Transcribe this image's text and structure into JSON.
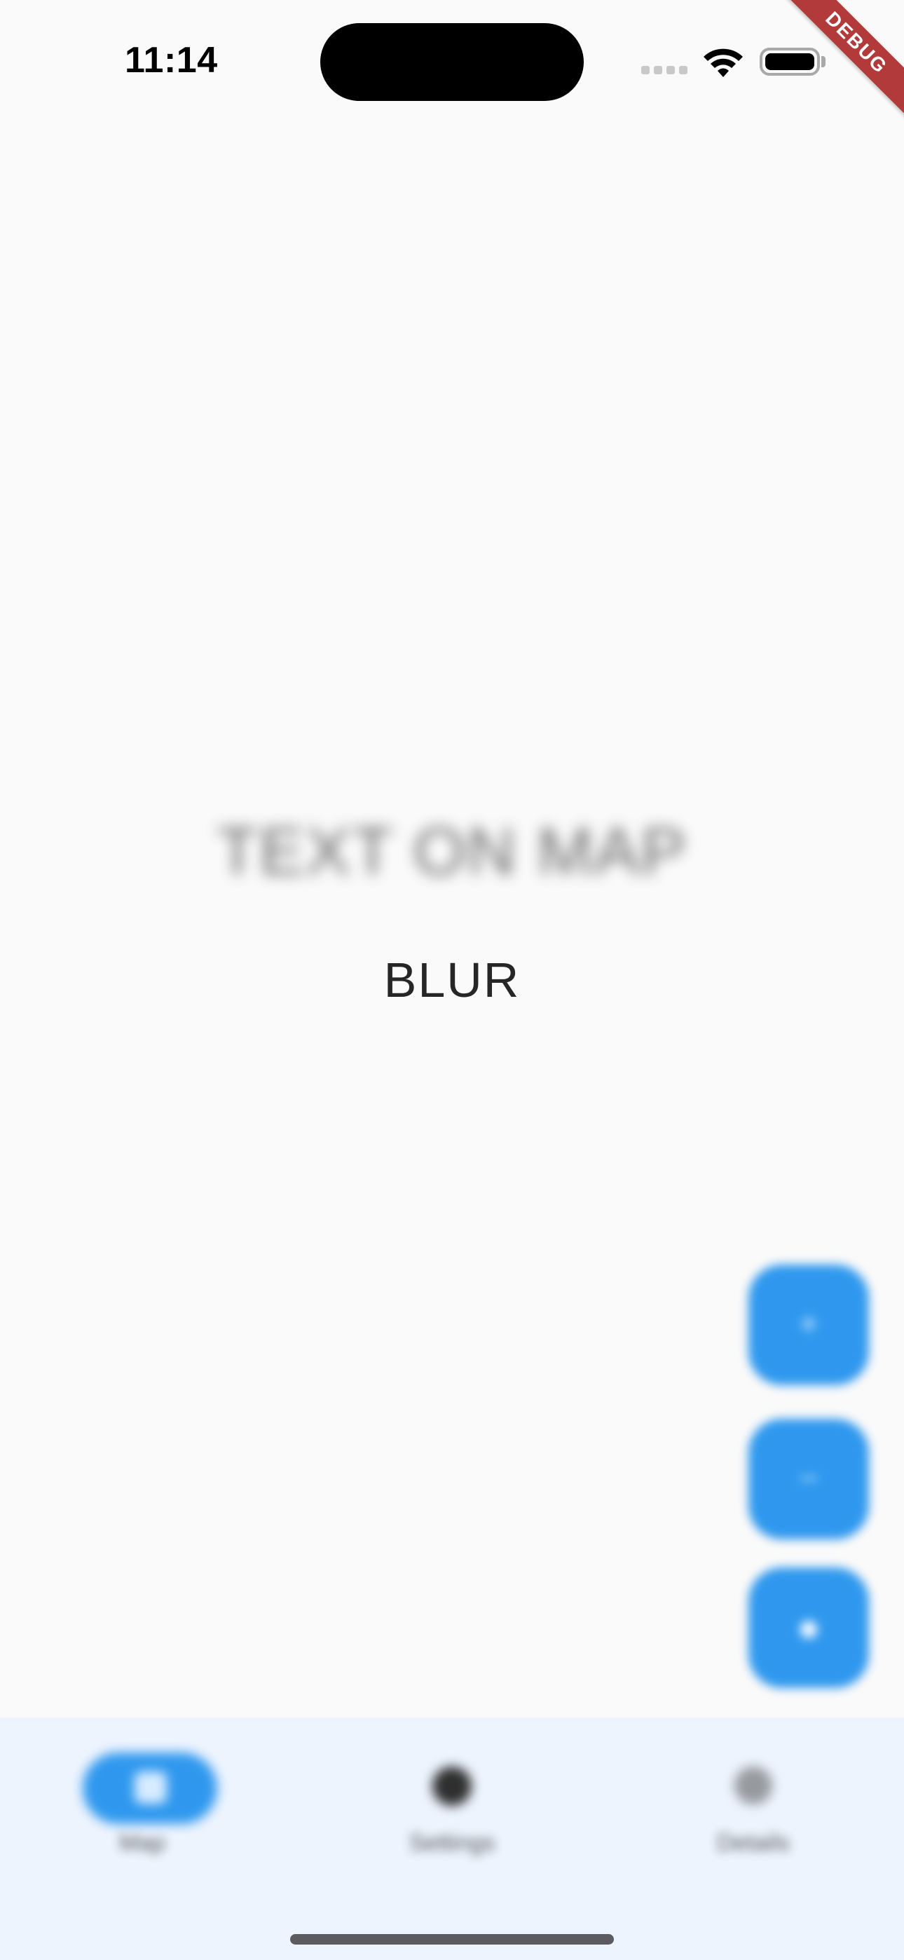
{
  "status_bar": {
    "time": "11:14",
    "signal_icon": "cellular-signal-icon",
    "wifi_icon": "wifi-icon",
    "battery_icon": "battery-icon"
  },
  "debug_banner": {
    "label": "DEBUG",
    "color": "#b33a3a"
  },
  "main": {
    "blurred_title": "TEXT ON MAP",
    "label": "BLUR"
  },
  "fabs": [
    {
      "icon": "plus-icon"
    },
    {
      "icon": "minus-icon"
    },
    {
      "icon": "location-icon"
    }
  ],
  "bottom_nav": {
    "items": [
      {
        "label": "Map",
        "icon": "map-icon",
        "selected": true
      },
      {
        "label": "Settings",
        "icon": "gear-icon",
        "selected": false
      },
      {
        "label": "Details",
        "icon": "info-icon",
        "selected": false
      }
    ]
  },
  "colors": {
    "accent": "#2f98ee",
    "background": "#fafafa",
    "nav_background": "#edf4fe"
  }
}
